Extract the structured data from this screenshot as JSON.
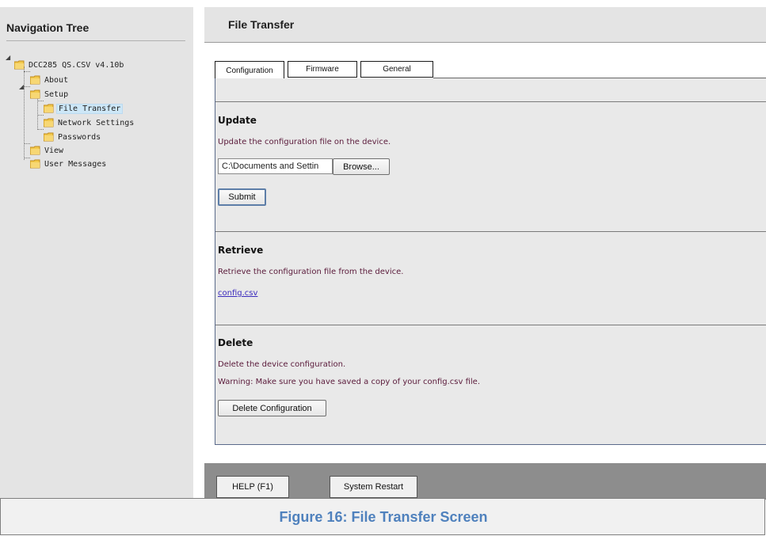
{
  "nav": {
    "title": "Navigation Tree",
    "tree": {
      "root": "DCC285 QS.CSV v4.10b",
      "about": "About",
      "setup": "Setup",
      "file_transfer": "File Transfer",
      "network_settings": "Network Settings",
      "passwords": "Passwords",
      "view": "View",
      "user_messages": "User Messages"
    },
    "selected": "File Transfer"
  },
  "main": {
    "title": "File Transfer",
    "tabs": [
      "Configuration",
      "Firmware",
      "General"
    ],
    "active_tab": "Configuration",
    "update": {
      "heading": "Update",
      "description": "Update the configuration file on the device.",
      "file_value": "C:\\Documents and Settin",
      "browse_label": "Browse...",
      "submit_label": "Submit"
    },
    "retrieve": {
      "heading": "Retrieve",
      "description": "Retrieve the configuration file from the device.",
      "link": "config.csv"
    },
    "delete": {
      "heading": "Delete",
      "description": "Delete the device configuration.",
      "warning": "Warning: Make sure you have saved a copy of your config.csv file.",
      "button_label": "Delete Configuration"
    }
  },
  "footer": {
    "help_label": "HELP (F1)",
    "restart_label": "System Restart"
  },
  "caption": "Figure 16: File Transfer Screen",
  "icons": {
    "folder": "folder-icon"
  },
  "colors": {
    "panel_bg": "#e4e4e4",
    "description_text": "#5a1a3a",
    "link": "#3b2bbd",
    "caption": "#4f81bd",
    "bottom_bar": "#8d8d8d"
  }
}
